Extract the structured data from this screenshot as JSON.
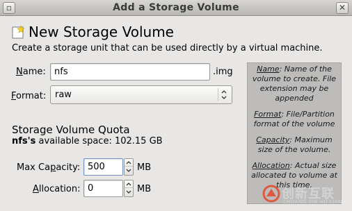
{
  "window": {
    "title": "Add a Storage Volume",
    "close_glyph": "✕",
    "menu_glyph": "▫"
  },
  "header": {
    "title": "New Storage Volume",
    "description": "Create a storage unit that can be used directly by a virtual machine.",
    "icon": "new-volume-icon"
  },
  "form": {
    "name_label_u": "N",
    "name_label_rest": "ame:",
    "name_value": "nfs",
    "name_suffix": ".img",
    "format_label_u": "F",
    "format_label_rest": "ormat:",
    "format_value": "raw"
  },
  "quota": {
    "title": "Storage Volume Quota",
    "pool_name": "nfs's",
    "available_text": " available space: 102.15 GB",
    "max_capacity_label_pre": "Max Ca",
    "max_capacity_label_u": "p",
    "max_capacity_label_post": "acity:",
    "max_capacity_value": "500",
    "max_capacity_unit": "MB",
    "allocation_label_u": "A",
    "allocation_label_rest": "llocation:",
    "allocation_value": "0",
    "allocation_unit": "MB"
  },
  "help": {
    "name_term": "Name",
    "name_text": ": Name of the volume to create. File extension may be appended",
    "format_term": "Format",
    "format_text": ": File/Partition format of the volume",
    "capacity_term": "Capacity",
    "capacity_text": ": Maximum size of the volume.",
    "allocation_term": "Allocation",
    "allocation_text": ": Actual size allocated to volume at this time."
  },
  "watermark": {
    "cn": "创新互联",
    "en": "CHUANG XIN HU LIAN"
  }
}
